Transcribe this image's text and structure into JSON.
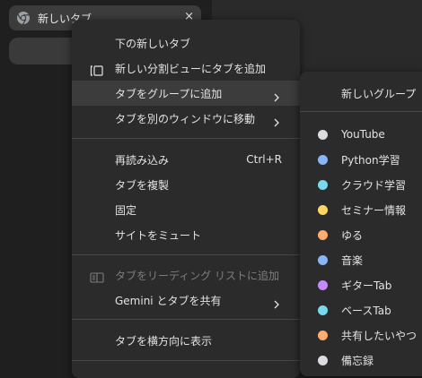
{
  "tab": {
    "title": "新しいタブ",
    "close_glyph": "×",
    "favicon_icon": "chrome-icon"
  },
  "context_menu": {
    "items": [
      {
        "label": "下の新しいタブ"
      },
      {
        "label": "新しい分割ビューにタブを追加",
        "icon": "split-view-icon"
      },
      {
        "label": "タブをグループに追加",
        "submenu": true,
        "highlighted": true
      },
      {
        "label": "タブを別のウィンドウに移動",
        "submenu": true
      },
      {
        "label": "再読み込み",
        "shortcut": "Ctrl+R"
      },
      {
        "label": "タブを複製"
      },
      {
        "label": "固定"
      },
      {
        "label": "サイトをミュート"
      },
      {
        "label": "タブをリーディング リストに追加",
        "icon": "reading-list-icon",
        "disabled": true
      },
      {
        "label": "Gemini とタブを共有",
        "submenu": true
      },
      {
        "label": "タブを横方向に表示"
      }
    ]
  },
  "group_submenu": {
    "new_group_label": "新しいグループ",
    "groups": [
      {
        "label": "YouTube",
        "color": "#dadce0"
      },
      {
        "label": "Python学習",
        "color": "#8ab4f8"
      },
      {
        "label": "クラウド学習",
        "color": "#78d9ec"
      },
      {
        "label": "セミナー情報",
        "color": "#fdd663"
      },
      {
        "label": "ゆる",
        "color": "#fcad70"
      },
      {
        "label": "音楽",
        "color": "#8ab4f8"
      },
      {
        "label": "ギターTab",
        "color": "#c58af9"
      },
      {
        "label": "ベースTab",
        "color": "#78d9ec"
      },
      {
        "label": "共有したいやつ",
        "color": "#fcad70"
      },
      {
        "label": "備忘録",
        "color": "#dadce0"
      }
    ]
  },
  "colors": {
    "menu_bg": "#2b2b2b",
    "highlight_bg": "#3c3c3c",
    "text": "#e3e3e3",
    "disabled_text": "#7d7d7d"
  }
}
